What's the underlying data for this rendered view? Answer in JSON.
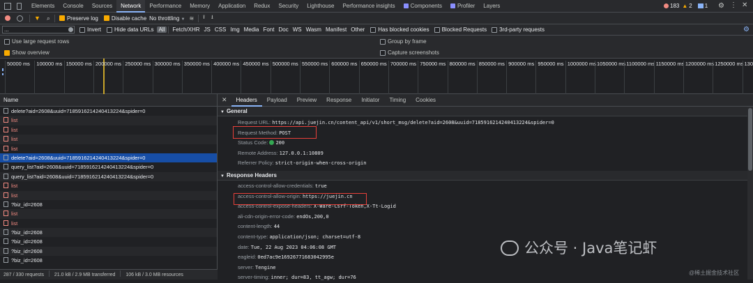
{
  "main_tabs": [
    "Elements",
    "Console",
    "Sources",
    "Network",
    "Performance",
    "Memory",
    "Application",
    "Redux",
    "Security",
    "Lighthouse",
    "Performance insights",
    "Components",
    "Profiler",
    "Layers"
  ],
  "badges": {
    "errors": "183",
    "warnings": "2",
    "info": "1"
  },
  "toolbar": {
    "preserve_log": "Preserve log",
    "disable_cache": "Disable cache",
    "throttling": "No throttling"
  },
  "filter": {
    "value": "...",
    "invert": "Invert",
    "hide_data_urls": "Hide data URLs",
    "types": [
      "All",
      "Fetch/XHR",
      "JS",
      "CSS",
      "Img",
      "Media",
      "Font",
      "Doc",
      "WS",
      "Wasm",
      "Manifest",
      "Other"
    ],
    "has_blocked_cookies": "Has blocked cookies",
    "blocked_requests": "Blocked Requests",
    "third_party": "3rd-party requests"
  },
  "settings": {
    "large_rows": "Use large request rows",
    "show_overview": "Show overview",
    "group_by_frame": "Group by frame",
    "capture_screenshots": "Capture screenshots"
  },
  "timeline_ticks": [
    "50000 ms",
    "100000 ms",
    "150000 ms",
    "200000 ms",
    "250000 ms",
    "300000 ms",
    "350000 ms",
    "400000 ms",
    "450000 ms",
    "500000 ms",
    "550000 ms",
    "600000 ms",
    "650000 ms",
    "700000 ms",
    "750000 ms",
    "800000 ms",
    "850000 ms",
    "900000 ms",
    "950000 ms",
    "1000000 ms",
    "1050000 ms",
    "1100000 ms",
    "1150000 ms",
    "1200000 ms",
    "1250000 ms",
    "13000"
  ],
  "list": {
    "header": "Name",
    "rows": [
      {
        "name": "delete?aid=2608&uuid=7185916214240413224&spider=0",
        "state": "normal"
      },
      {
        "name": "list",
        "state": "error"
      },
      {
        "name": "list",
        "state": "error"
      },
      {
        "name": "list",
        "state": "error"
      },
      {
        "name": "list",
        "state": "error"
      },
      {
        "name": "delete?aid=2608&uuid=7185916214240413224&spider=0",
        "state": "selected"
      },
      {
        "name": "query_list?aid=2608&uuid=7185916214240413224&spider=0",
        "state": "normal"
      },
      {
        "name": "query_list?aid=2608&uuid=7185916214240413224&spider=0",
        "state": "normal"
      },
      {
        "name": "list",
        "state": "error"
      },
      {
        "name": "list",
        "state": "error"
      },
      {
        "name": "?biz_id=2608",
        "state": "normal"
      },
      {
        "name": "list",
        "state": "error"
      },
      {
        "name": "list",
        "state": "error"
      },
      {
        "name": "?biz_id=2608",
        "state": "normal"
      },
      {
        "name": "?biz_id=2608",
        "state": "normal"
      },
      {
        "name": "?biz_id=2608",
        "state": "normal"
      },
      {
        "name": "?biz_id=2608",
        "state": "normal"
      }
    ]
  },
  "status": {
    "requests": "287 / 330 requests",
    "transferred": "21.0 kB / 2.9 MB transferred",
    "resources": "106 kB / 3.0 MB resources"
  },
  "detail_tabs": [
    "Headers",
    "Payload",
    "Preview",
    "Response",
    "Initiator",
    "Timing",
    "Cookies"
  ],
  "general": {
    "title": "General",
    "rows": [
      {
        "k": "Request URL:",
        "v": "https://api.juejin.cn/content_api/v1/short_msg/delete?aid=2608&uuid=7185916214240413224&spider=0"
      },
      {
        "k": "Request Method:",
        "v": "POST"
      },
      {
        "k": "Status Code:",
        "v": "200"
      },
      {
        "k": "Remote Address:",
        "v": "127.0.0.1:10809"
      },
      {
        "k": "Referrer Policy:",
        "v": "strict-origin-when-cross-origin"
      }
    ]
  },
  "response_headers": {
    "title": "Response Headers",
    "rows": [
      {
        "k": "access-control-allow-credentials:",
        "v": "true"
      },
      {
        "k": "access-control-allow-origin:",
        "v": "https://juejin.cn"
      },
      {
        "k": "access-control-expose-headers:",
        "v": "X-Ware-Csrf-Token,X-Tt-Logid"
      },
      {
        "k": "ali-cdn-origin-error-code:",
        "v": "endOs,200,0"
      },
      {
        "k": "content-length:",
        "v": "44"
      },
      {
        "k": "content-type:",
        "v": "application/json; charset=utf-8"
      },
      {
        "k": "date:",
        "v": "Tue, 22 Aug 2023 04:06:08 GMT"
      },
      {
        "k": "eagleid:",
        "v": "0ed7ac9e16926771683042995e"
      },
      {
        "k": "server:",
        "v": "Tengine"
      },
      {
        "k": "server-timing:",
        "v": "inner; dur=83, tt_agw; dur=76"
      }
    ]
  },
  "watermark": "公众号 · Java笔记虾",
  "watermark_small": "@稀土掘金技术社区",
  "colors": {
    "accent": "#8ab4f8",
    "error": "#f28b82",
    "selected": "#174ea6",
    "highlight_box": "#e8403a",
    "status_ok": "#34a853"
  }
}
